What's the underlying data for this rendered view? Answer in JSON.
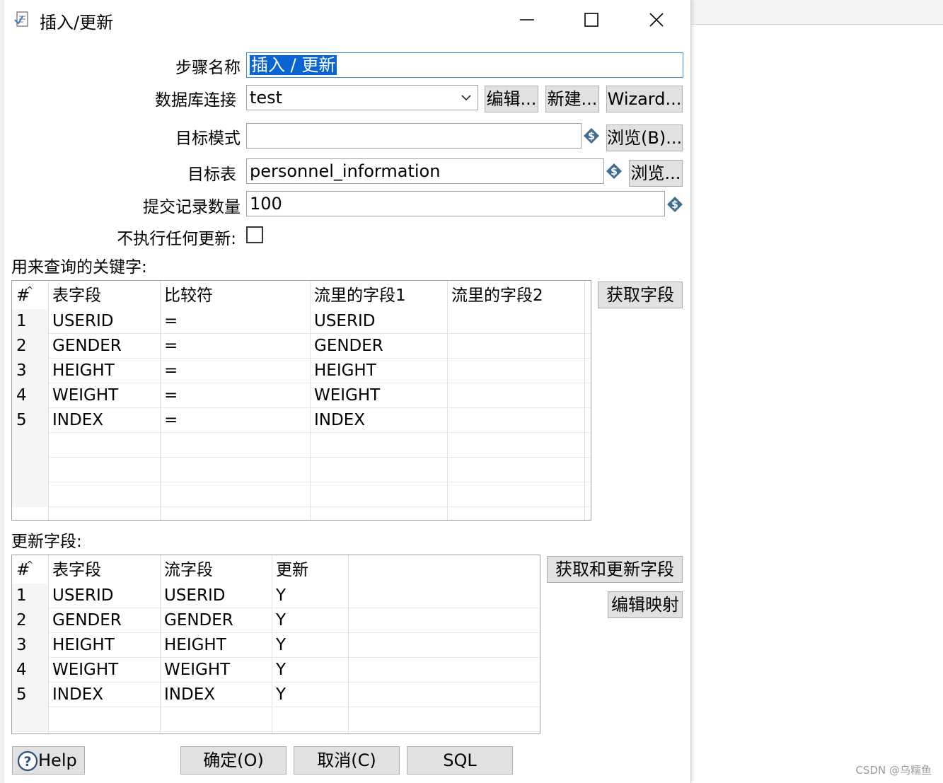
{
  "window": {
    "title": "插入/更新"
  },
  "form": {
    "step_name_label": "步骤名称",
    "step_name_value": "插入 / 更新",
    "db_conn_label": "数据库连接",
    "db_conn_value": "test",
    "edit_btn": "编辑...",
    "new_btn": "新建...",
    "wizard_btn": "Wizard...",
    "target_schema_label": "目标模式",
    "target_schema_value": "",
    "browse_b_btn": "浏览(B)...",
    "target_table_label": "目标表",
    "target_table_value": "personnel_information",
    "browse_btn": "浏览...",
    "commit_size_label": "提交记录数量",
    "commit_size_value": "100",
    "no_update_label": "不执行任何更新:"
  },
  "keys_section": {
    "label": "用来查询的关键字:",
    "get_fields_btn": "获取字段",
    "columns": [
      "#",
      "表字段",
      "比较符",
      "流里的字段1",
      "流里的字段2"
    ],
    "rows": [
      [
        "1",
        "USERID",
        "=",
        "USERID",
        ""
      ],
      [
        "2",
        "GENDER",
        "=",
        "GENDER",
        ""
      ],
      [
        "3",
        "HEIGHT",
        "=",
        "HEIGHT",
        ""
      ],
      [
        "4",
        "WEIGHT",
        "=",
        "WEIGHT",
        ""
      ],
      [
        "5",
        "INDEX",
        "=",
        "INDEX",
        ""
      ]
    ]
  },
  "update_section": {
    "label": "更新字段:",
    "get_update_btn": "获取和更新字段",
    "edit_mapping_btn": "编辑映射",
    "columns": [
      "#",
      "表字段",
      "流字段",
      "更新"
    ],
    "rows": [
      [
        "1",
        "USERID",
        "USERID",
        "Y"
      ],
      [
        "2",
        "GENDER",
        "GENDER",
        "Y"
      ],
      [
        "3",
        "HEIGHT",
        "HEIGHT",
        "Y"
      ],
      [
        "4",
        "WEIGHT",
        "WEIGHT",
        "Y"
      ],
      [
        "5",
        "INDEX",
        "INDEX",
        "Y"
      ]
    ]
  },
  "footer": {
    "help_btn": "Help",
    "ok_btn": "确定(O)",
    "cancel_btn": "取消(C)",
    "sql_btn": "SQL"
  },
  "watermark": "CSDN @乌糯鱼",
  "colors": {
    "selection": "#0a64d2",
    "focus_border": "#3c8dd8",
    "button_bg": "#e1e1e1",
    "variable_icon": "#3d6e8f"
  },
  "icons": [
    "dialog-app-icon",
    "minimize-icon",
    "maximize-icon",
    "close-icon",
    "chevron-down-icon",
    "variable-icon",
    "help-icon"
  ]
}
